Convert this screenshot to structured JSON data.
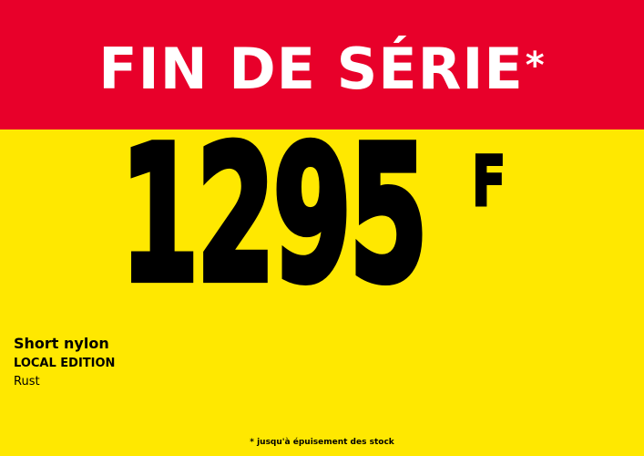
{
  "colors": {
    "banner_background": "#E8002A",
    "page_background": "#FFE800",
    "banner_text": "#FFFFFF",
    "body_text": "#000000"
  },
  "banner": {
    "title": "FIN DE SÉRIE",
    "asterisk": "*"
  },
  "price": {
    "amount": "1295",
    "currency": "F"
  },
  "product": {
    "name": "Short nylon",
    "edition": "LOCAL EDITION",
    "color": "Rust"
  },
  "footnote": "* jusqu'à épuisement des stock"
}
